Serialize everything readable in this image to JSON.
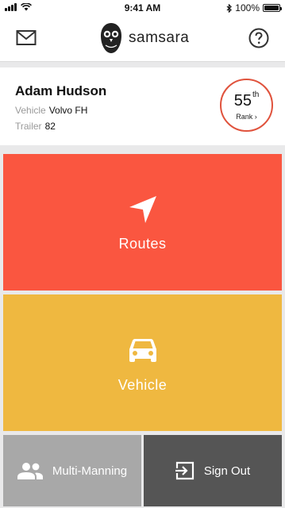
{
  "status_bar": {
    "time": "9:41 AM",
    "battery_text": "100%"
  },
  "header": {
    "brand": "samsara",
    "mail_icon": "mail-icon",
    "help_icon": "help-icon"
  },
  "driver": {
    "name": "Adam Hudson",
    "vehicle_label": "Vehicle",
    "vehicle_value": "Volvo FH",
    "trailer_label": "Trailer",
    "trailer_value": "82"
  },
  "rank": {
    "number": "55",
    "suffix": "th",
    "label": "Rank ›"
  },
  "tiles": {
    "routes": {
      "label": "Routes",
      "icon": "navigation-arrow-icon",
      "color": "#fa5640"
    },
    "vehicle": {
      "label": "Vehicle",
      "icon": "car-icon",
      "color": "#efb840"
    },
    "multi_manning": {
      "label": "Multi-Manning",
      "icon": "people-icon",
      "color": "#a8a8a8"
    },
    "sign_out": {
      "label": "Sign Out",
      "icon": "sign-out-icon",
      "color": "#555555"
    }
  },
  "colors": {
    "accent": "#e0533d",
    "page_bg": "#e9e9ea"
  }
}
